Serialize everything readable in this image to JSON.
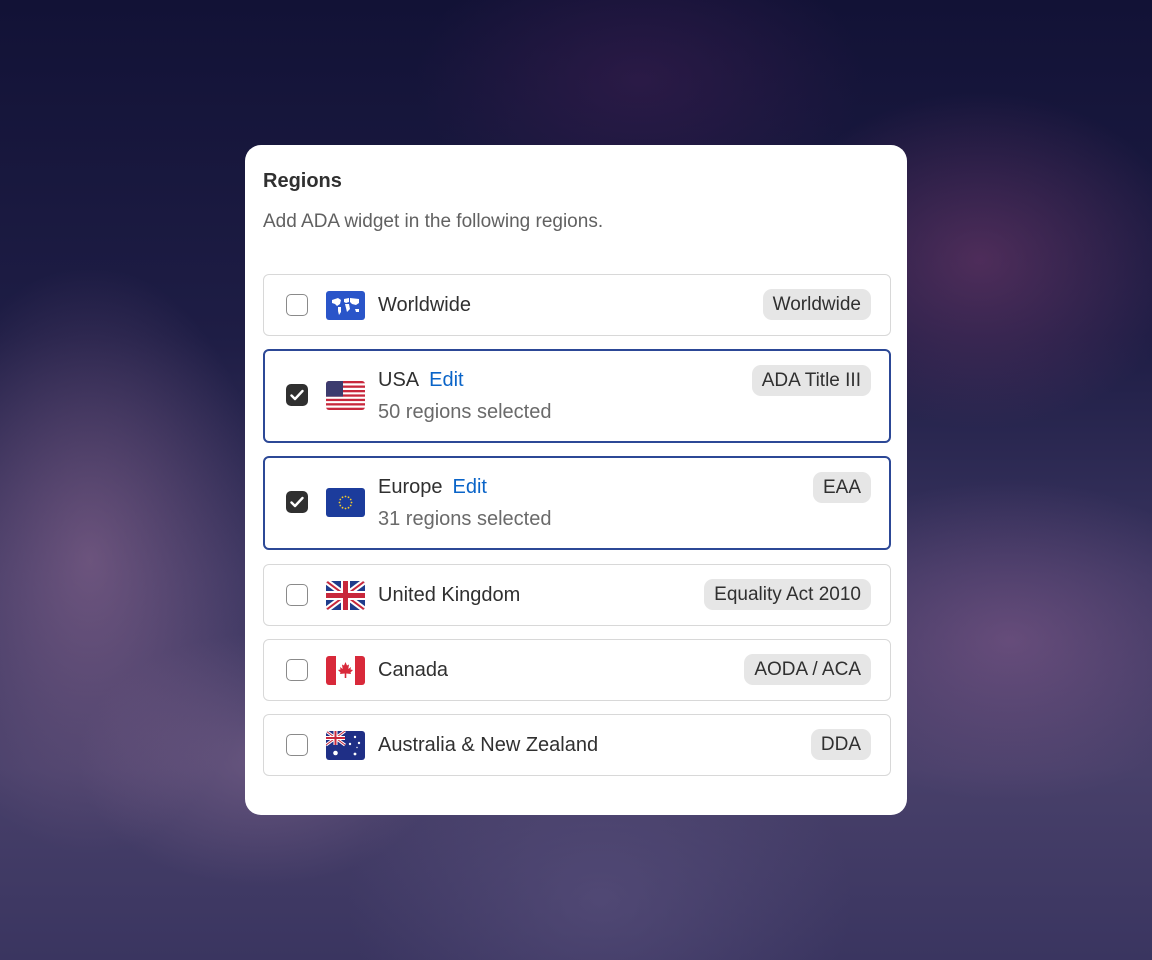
{
  "modal": {
    "title": "Regions",
    "subtitle": "Add ADA widget in the following regions."
  },
  "regions": [
    {
      "name": "Worldwide",
      "badge": "Worldwide",
      "checked": false,
      "flag_icon": "world-map-icon"
    },
    {
      "name": "USA",
      "edit_label": "Edit",
      "selected_text": "50 regions selected",
      "badge": "ADA Title III",
      "checked": true,
      "flag_icon": "usa-flag-icon"
    },
    {
      "name": "Europe",
      "edit_label": "Edit",
      "selected_text": "31 regions selected",
      "badge": "EAA",
      "checked": true,
      "flag_icon": "eu-flag-icon"
    },
    {
      "name": "United Kingdom",
      "badge": "Equality Act 2010",
      "checked": false,
      "flag_icon": "uk-flag-icon"
    },
    {
      "name": "Canada",
      "badge": "AODA / ACA",
      "checked": false,
      "flag_icon": "canada-flag-icon"
    },
    {
      "name": "Australia & New Zealand",
      "badge": "DDA",
      "checked": false,
      "flag_icon": "australia-flag-icon"
    }
  ],
  "colors": {
    "selected_border": "#2c4896",
    "link": "#0a64c8",
    "checkbox_checked": "#303030",
    "badge_bg": "#e6e6e6"
  }
}
